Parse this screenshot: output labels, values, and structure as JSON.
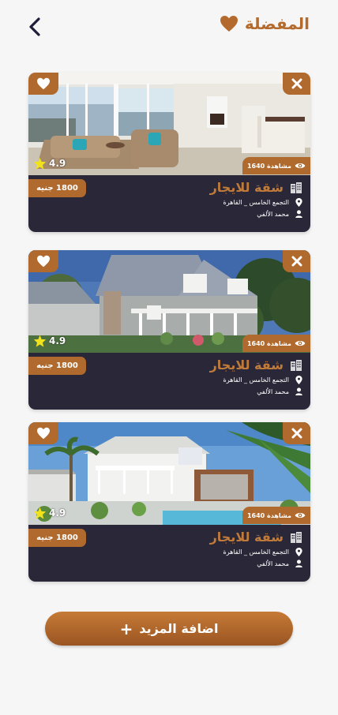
{
  "header": {
    "title": "المفضلة",
    "heart_color": "#b46a2c"
  },
  "listings": [
    {
      "title": "شقة للايجار",
      "location": "التجمع الخامس _ القاهرة",
      "owner": "محمد الألفي",
      "price": "1800 جنيه",
      "views": "1640 مشاهدة",
      "rating": "4.9"
    },
    {
      "title": "شقة للايجار",
      "location": "التجمع الخامس _ القاهرة",
      "owner": "محمد الألفي",
      "price": "1800 جنيه",
      "views": "1640 مشاهدة",
      "rating": "4.9"
    },
    {
      "title": "شقة للايجار",
      "location": "التجمع الخامس _ القاهرة",
      "owner": "محمد الألفي",
      "price": "1800 جنيه",
      "views": "1640 مشاهدة",
      "rating": "4.9"
    }
  ],
  "footer": {
    "add_more_label": "اضافة المزيد"
  },
  "colors": {
    "accent": "#b06a2e",
    "card_bg": "#2a2838",
    "title_text": "#c07a3a",
    "star": "#f2e21a"
  }
}
